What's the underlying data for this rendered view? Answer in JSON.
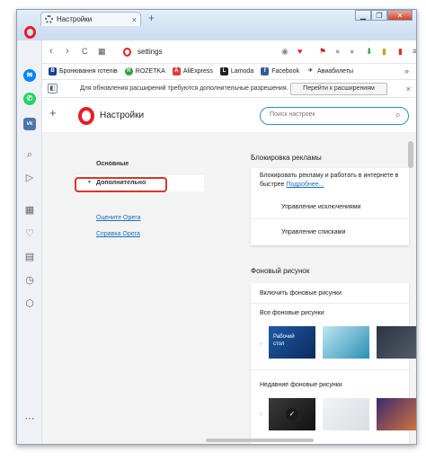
{
  "window": {
    "tab_title": "Настройки",
    "tab_close": "×",
    "new_tab": "+",
    "controls": [
      "▁",
      "❐",
      "✕"
    ]
  },
  "addressbar": {
    "url": "settings",
    "back": "‹",
    "forward": "›",
    "reload": "C"
  },
  "bookmarks": {
    "items": [
      {
        "label": "Бронювання готелів",
        "icon": "B",
        "color": "#1c3f94"
      },
      {
        "label": "ROZETKA",
        "icon": "R",
        "color": "#2e9e3e"
      },
      {
        "label": "AliExpress",
        "icon": "A",
        "color": "#e4393c"
      },
      {
        "label": "Lamoda",
        "icon": "L",
        "color": "#222222"
      },
      {
        "label": "Facebook",
        "icon": "f",
        "color": "#3b5998"
      },
      {
        "label": "Авиабилеты",
        "icon": "✈",
        "color": "#f0a500"
      }
    ],
    "more": "»"
  },
  "notice": {
    "text": "Для обновления расширений требуются дополнительные разрешения.",
    "button": "Перейти к расширениям",
    "close": "×"
  },
  "settings": {
    "title": "Настройки",
    "search_placeholder": "Поиск настроек",
    "plus": "+"
  },
  "leftnav": {
    "basic": "Основные",
    "advanced": "Дополнительно",
    "rate_opera": "Оцените Opera",
    "help_opera": "Справка Opera"
  },
  "adblock": {
    "title": "Блокировка рекламы",
    "text_line1": "Блокировать рекламу и работать в интернете в",
    "text_line2": "быстрее",
    "more_link": "Подробнее...",
    "exceptions": "Управление исключениями",
    "lists": "Управление списками"
  },
  "wallpaper": {
    "title": "Фоновый рисунок",
    "enable": "Включить фоновые рисунки",
    "all": "Все фоновые рисунки",
    "desktop_label_1": "Рабочий",
    "desktop_label_2": "стол",
    "recent": "Недавние фоновые рисунки",
    "prev": "‹"
  },
  "colors": {
    "opera_red": "#e81c2a",
    "link_blue": "#1a6fc0",
    "highlight_red": "#d9332b",
    "search_border": "#2f8fd1"
  }
}
